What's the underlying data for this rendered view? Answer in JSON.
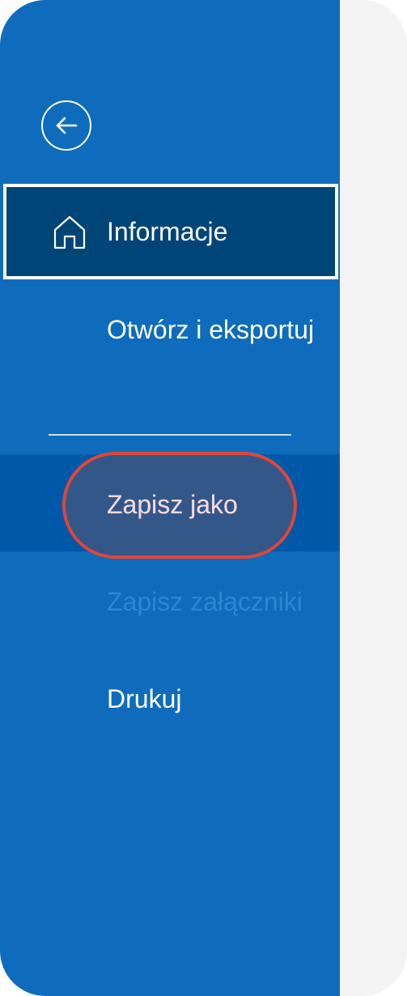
{
  "sidebar": {
    "back_icon": "arrow-left-circle-icon",
    "items": [
      {
        "label": "Informacje",
        "icon": "home-icon",
        "state": "selected"
      },
      {
        "label": "Otwórz i eksportuj"
      },
      {
        "label": "Zapisz jako",
        "state": "highlighted"
      },
      {
        "label": "Zapisz załączniki",
        "state": "disabled"
      },
      {
        "label": "Drukuj"
      }
    ]
  },
  "colors": {
    "sidebar_bg": "#0f6cbd",
    "selected_bg": "#004578",
    "hover_bg": "#0058a8",
    "highlight_outline": "#e04638",
    "content_bg": "#f3f3f3"
  }
}
